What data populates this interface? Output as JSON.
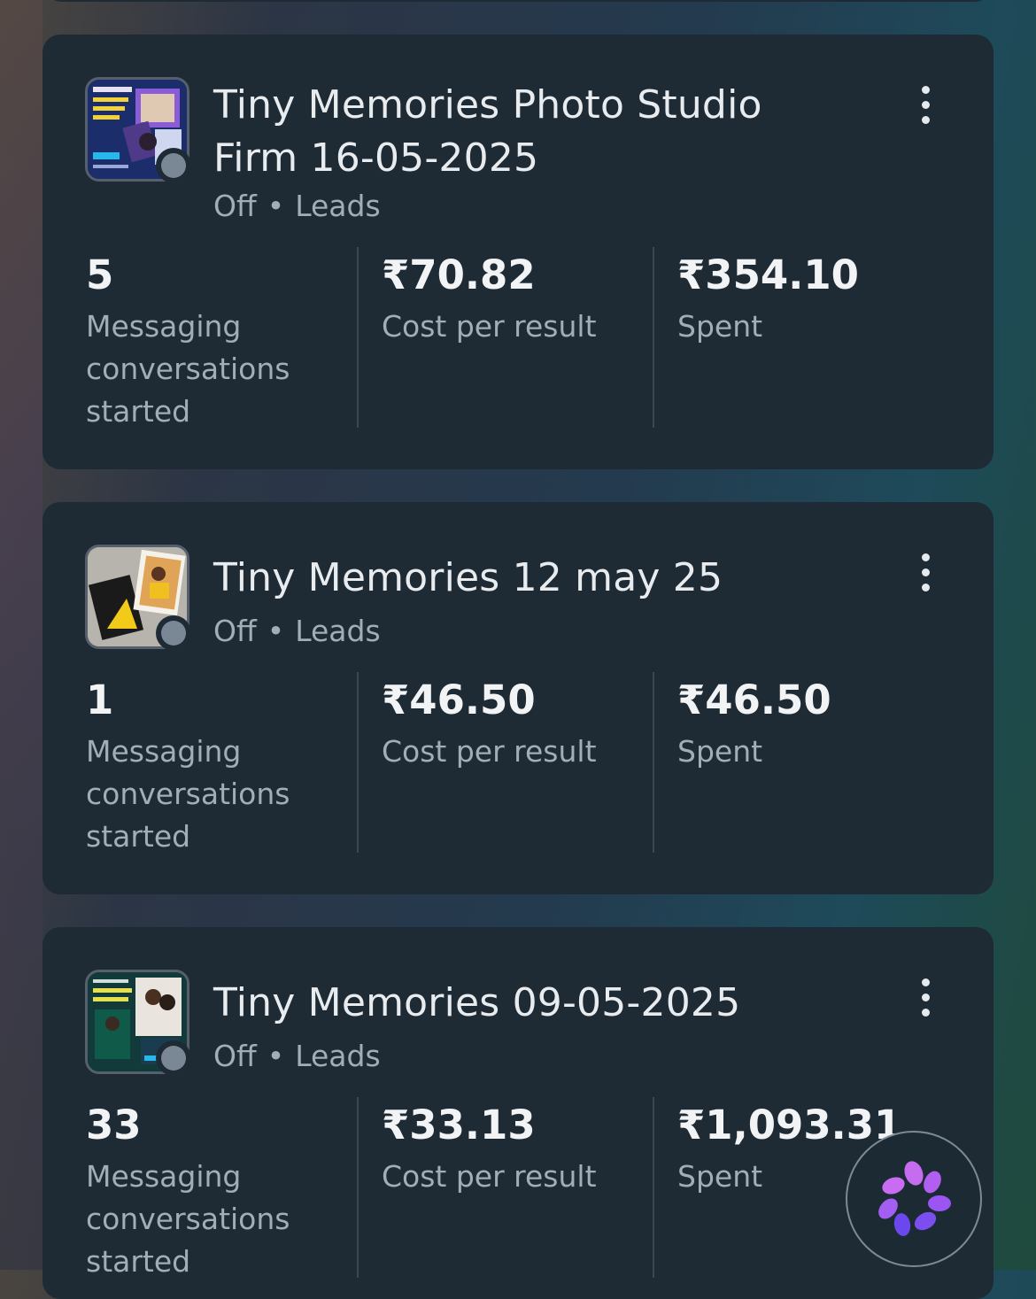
{
  "campaigns": [
    {
      "title": "Tiny Memories Photo Studio Firm 16-05-2025",
      "status": "Off",
      "objective": "Leads",
      "results_value": "5",
      "results_label": "Messaging conversations started",
      "cost_value": "₹70.82",
      "cost_label": "Cost per result",
      "spent_value": "₹354.10",
      "spent_label": "Spent"
    },
    {
      "title": "Tiny Memories 12 may 25",
      "status": "Off",
      "objective": "Leads",
      "results_value": "1",
      "results_label": "Messaging conversations started",
      "cost_value": "₹46.50",
      "cost_label": "Cost per result",
      "spent_value": "₹46.50",
      "spent_label": "Spent"
    },
    {
      "title": "Tiny Memories 09-05-2025",
      "status": "Off",
      "objective": "Leads",
      "results_value": "33",
      "results_label": "Messaging conversations started",
      "cost_value": "₹33.13",
      "cost_label": "Cost per result",
      "spent_value": "₹1,093.31",
      "spent_label": "Spent"
    }
  ],
  "separator": "•",
  "icons": {
    "more": "more-vertical-icon",
    "status": "status-off-dot-icon",
    "assistant": "ai-assistant-icon"
  },
  "colors": {
    "card_bg": "#1e2a34",
    "status_dot": "#7a8896",
    "assistant_petals": "#a25ff2"
  }
}
